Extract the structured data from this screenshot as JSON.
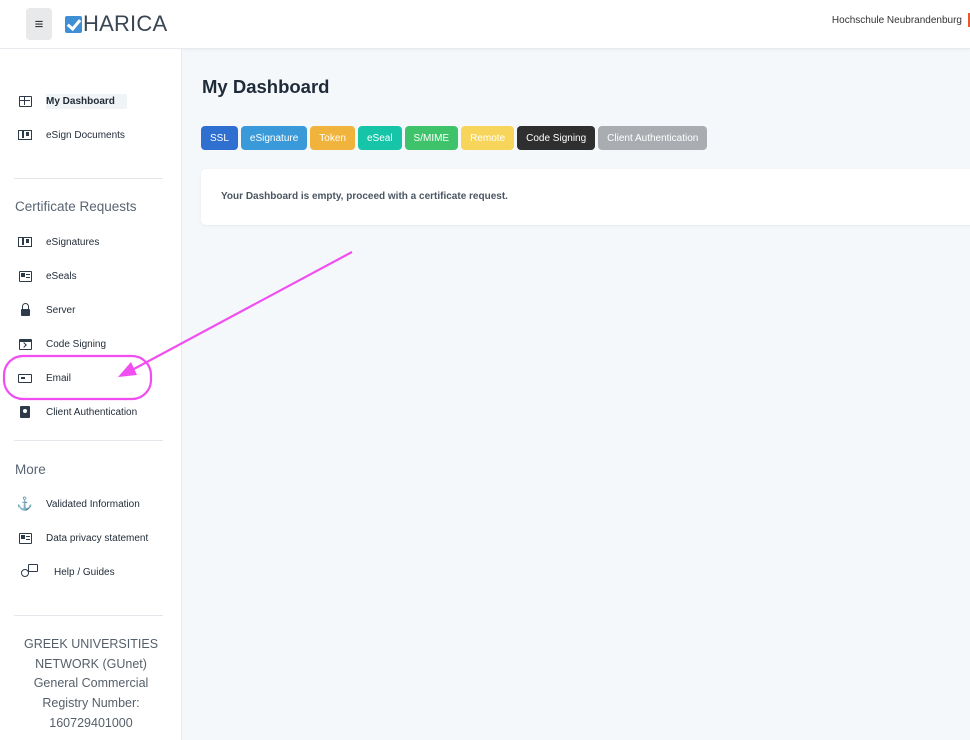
{
  "header": {
    "menu_icon": "hamburger-icon",
    "logo_text": "HARICA",
    "organization": "Hochschule Neubrandenburg"
  },
  "sidebar": {
    "main_items": [
      {
        "label": "My Dashboard",
        "icon": "dashboard-icon",
        "active": true
      },
      {
        "label": "eSign Documents",
        "icon": "esign-icon"
      }
    ],
    "cert_section_title": "Certificate Requests",
    "cert_items": [
      {
        "label": "eSignatures",
        "icon": "esignature-icon"
      },
      {
        "label": "eSeals",
        "icon": "eseal-icon"
      },
      {
        "label": "Server",
        "icon": "lock-icon"
      },
      {
        "label": "Code Signing",
        "icon": "code-signing-icon"
      },
      {
        "label": "Email",
        "icon": "email-icon"
      },
      {
        "label": "Client Authentication",
        "icon": "badge-icon"
      }
    ],
    "more_section_title": "More",
    "more_items": [
      {
        "label": "Validated Information",
        "icon": "anchor-icon"
      },
      {
        "label": "Data privacy statement",
        "icon": "privacy-icon"
      },
      {
        "label": "Help / Guides",
        "icon": "help-icon"
      }
    ],
    "footer": [
      "GREEK UNIVERSITIES",
      "NETWORK (GUnet)",
      "General Commercial",
      "Registry Number:",
      "160729401000"
    ]
  },
  "main": {
    "title": "My Dashboard",
    "tags": [
      {
        "label": "SSL",
        "color": "#2f6fd0"
      },
      {
        "label": "eSignature",
        "color": "#3a9ad9"
      },
      {
        "label": "Token",
        "color": "#f0b43c"
      },
      {
        "label": "eSeal",
        "color": "#16c4a8"
      },
      {
        "label": "S/MIME",
        "color": "#3ec36a"
      },
      {
        "label": "Remote",
        "color": "#f7d55a"
      },
      {
        "label": "Code Signing",
        "color": "#2f2f2f"
      },
      {
        "label": "Client Authentication",
        "color": "#a9adb1"
      }
    ],
    "empty_message": "Your Dashboard is empty, proceed with a certificate request."
  },
  "annotation_color": "#f04ef0"
}
